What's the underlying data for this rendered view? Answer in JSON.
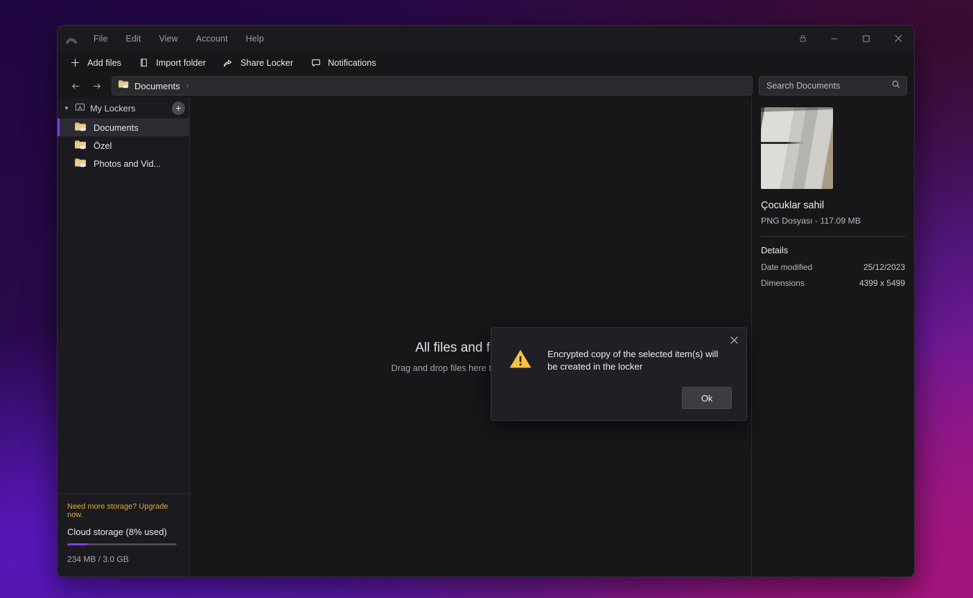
{
  "window": {
    "menu": [
      "File",
      "Edit",
      "View",
      "Account",
      "Help"
    ],
    "controls": {
      "lock": "lock-icon",
      "minimize": "minimize-icon",
      "maximize": "maximize-icon",
      "close": "close-icon"
    }
  },
  "toolbar": {
    "items": [
      {
        "label": "Add files",
        "icon": "plus-icon"
      },
      {
        "label": "Import folder",
        "icon": "import-folder-icon"
      },
      {
        "label": "Share Locker",
        "icon": "share-icon"
      },
      {
        "label": "Notifications",
        "icon": "notification-icon"
      }
    ]
  },
  "addressbar": {
    "back": "back-arrow-icon",
    "forward": "forward-arrow-icon",
    "breadcrumb": "Documents",
    "breadcrumb_separator": "›",
    "search_placeholder": "Search Documents",
    "search_value": ""
  },
  "sidebar": {
    "header": "My Lockers",
    "add_tooltip": "+",
    "items": [
      {
        "label": "Documents",
        "selected": true
      },
      {
        "label": "Özel",
        "selected": false
      },
      {
        "label": "Photos and Vid...",
        "selected": false
      }
    ],
    "storage": {
      "upgrade": "Need more storage? Upgrade now.",
      "title": "Cloud storage (8% used)",
      "percent": 8,
      "used_of_total": "234 MB / 3.0 GB"
    }
  },
  "main": {
    "empty_title": "All files and folders",
    "empty_subtitle": "Drag and drop files here to encrypt them"
  },
  "details": {
    "file_name": "Çocuklar sahil",
    "file_meta": "PNG Dosyası - 117.09 MB",
    "section_title": "Details",
    "rows": [
      {
        "label": "Date modified",
        "value": "25/12/2023"
      },
      {
        "label": "Dimensions",
        "value": "4399 x 5499"
      }
    ]
  },
  "dialog": {
    "message": "Encrypted copy of the selected item(s) will be created in the locker",
    "ok_label": "Ok",
    "close_icon": "close-icon",
    "warning_icon": "warning-triangle-icon"
  },
  "colors": {
    "accent": "#7b3fe4",
    "warning": "#f5c243",
    "upgrade_link": "#e0a63c",
    "window_bg": "#171719",
    "panel_bg": "#1b1b1f"
  }
}
